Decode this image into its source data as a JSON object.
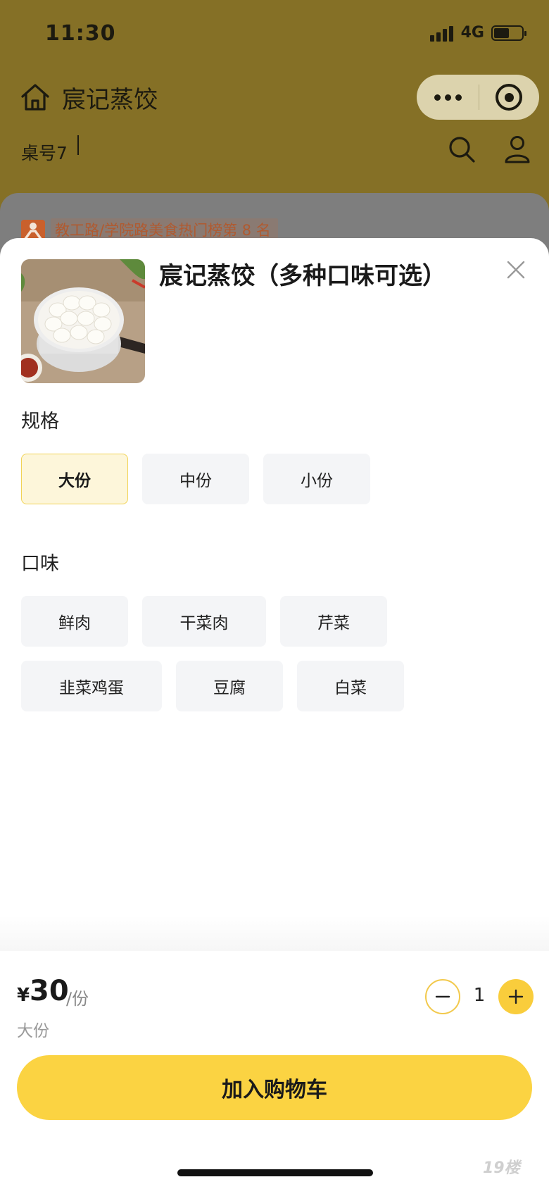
{
  "status": {
    "time": "11:30",
    "network": "4G",
    "battery_level": 0.55
  },
  "header": {
    "title": "宸记蒸饺",
    "table": "桌号7",
    "rank_banner": "教工路/学院路美食热门榜第 8 名"
  },
  "product": {
    "name": "宸记蒸饺（多种口味可选）"
  },
  "sections": {
    "spec_label": "规格",
    "spec_options": [
      "大份",
      "中份",
      "小份"
    ],
    "spec_selected": "大份",
    "taste_label": "口味",
    "taste_options": [
      "鲜肉",
      "干菜肉",
      "芹菜",
      "韭菜鸡蛋",
      "豆腐",
      "白菜"
    ]
  },
  "footer": {
    "currency": "¥",
    "price": "30",
    "unit": "/份",
    "selected_summary": "大份",
    "quantity": "1",
    "add_to_cart": "加入购物车"
  },
  "watermark": "19楼",
  "colors": {
    "accent": "#fbd342",
    "header_dim": "#857026",
    "selected_bg": "#fdf6da"
  }
}
